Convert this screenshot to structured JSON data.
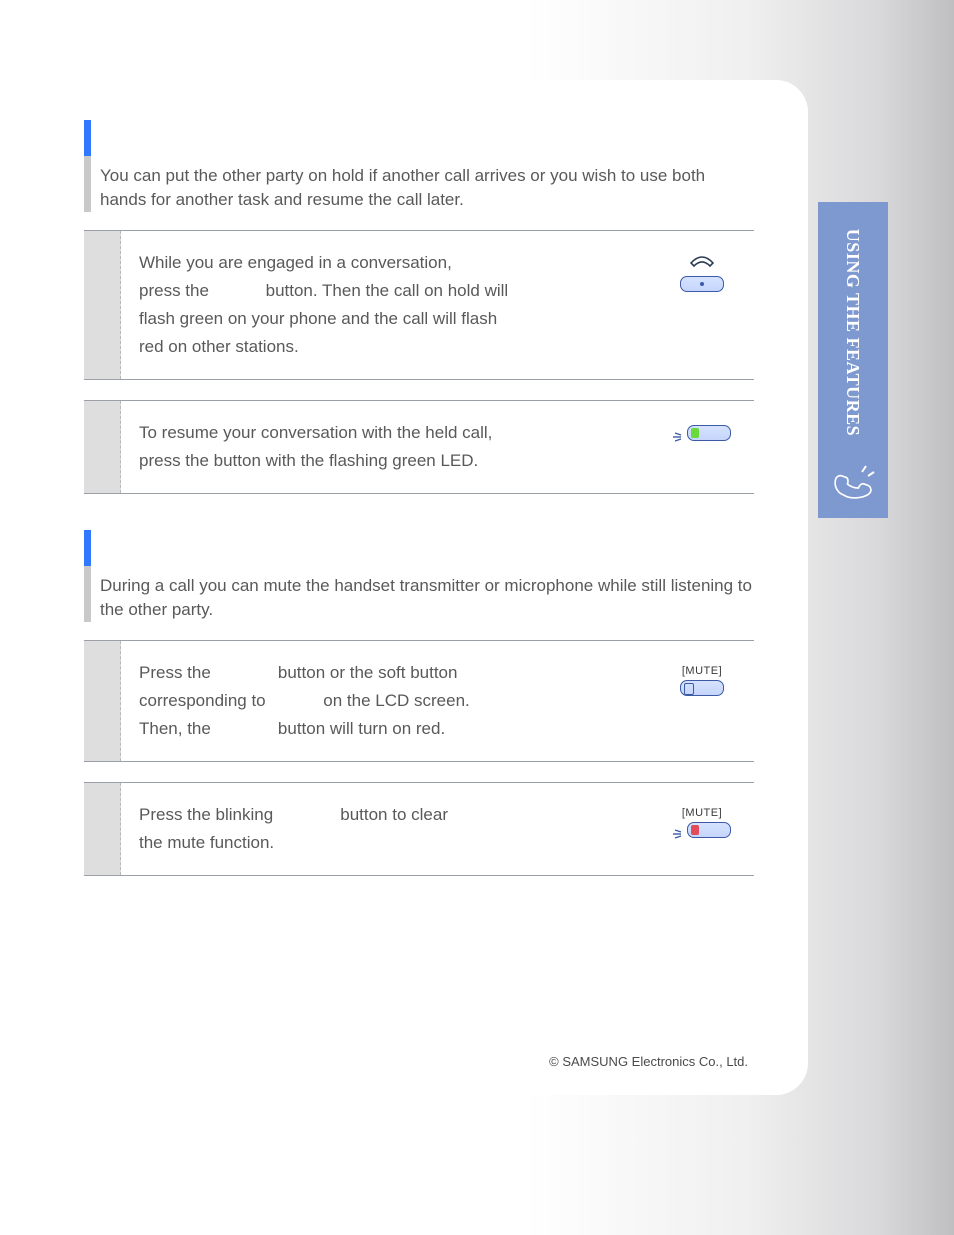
{
  "sidebar": {
    "label": "USING THE FEATURES"
  },
  "hold": {
    "intro": "You can put the other party on hold if another call arrives or you wish to use both hands for another task and resume the call later.",
    "step1": {
      "t1": "While you are engaged in a conversation,",
      "t2a": "press the ",
      "t2b": " button. Then the call on hold will",
      "t3": "flash green on your phone and the call will flash",
      "t4": "red on other stations."
    },
    "step2": {
      "t1": "To resume your conversation with the held call,",
      "t2": "press the button with the flashing green LED."
    }
  },
  "mute": {
    "intro": "During a call you can mute the handset transmitter or microphone while still listening to the other party.",
    "step1": {
      "t1a": "Press the ",
      "t1b": " button or the soft button",
      "t2a": "corresponding to ",
      "t2b": " on the LCD screen.",
      "t3a": "Then, the ",
      "t3b": " button will turn on red."
    },
    "step2": {
      "t1a": "Press the blinking ",
      "t1b": " button to clear",
      "t2": "the mute function."
    },
    "label": "[MUTE]"
  },
  "footer": {
    "copyright": "© SAMSUNG Electronics Co., Ltd."
  }
}
